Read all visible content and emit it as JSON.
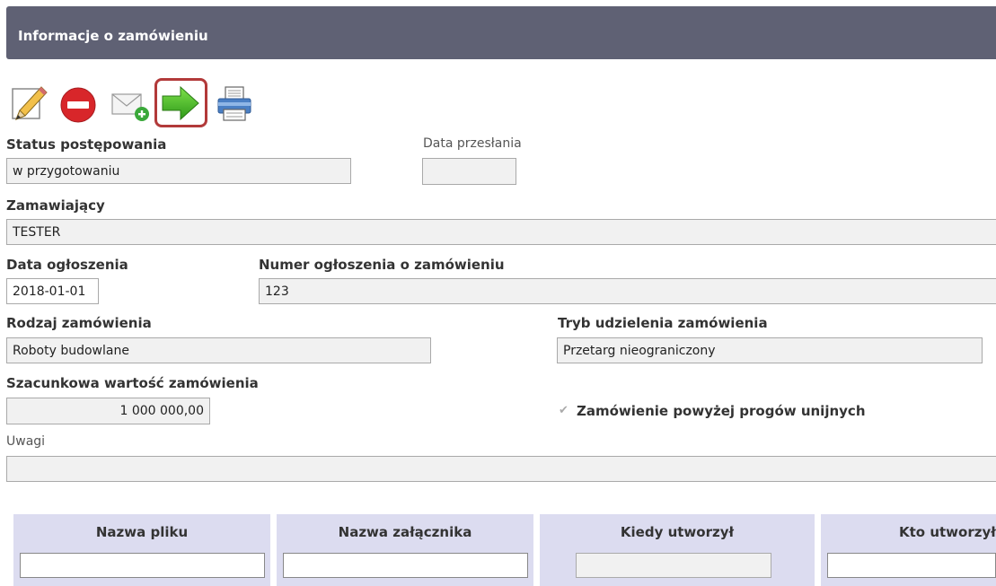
{
  "header": {
    "title": "Informacje o zamówieniu"
  },
  "toolbar": {
    "edit_icon": "pencil-icon",
    "delete_icon": "no-entry-icon",
    "message_icon": "envelope-add-icon",
    "forward_icon": "green-arrow-right-icon",
    "print_icon": "printer-icon",
    "highlight_color": "#b23a3a"
  },
  "form": {
    "status_label": "Status postępowania",
    "status_value": "w przygotowaniu",
    "sent_date_label": "Data przesłania",
    "sent_date_value": "",
    "buyer_label": "Zamawiający",
    "buyer_value": "TESTER",
    "notice_date_label": "Data ogłoszenia",
    "notice_date_value": "2018-01-01",
    "notice_number_label": "Numer ogłoszenia o zamówieniu",
    "notice_number_value": "123",
    "order_type_label": "Rodzaj zamówienia",
    "order_type_value": "Roboty budowlane",
    "procedure_label": "Tryb udzielenia zamówienia",
    "procedure_value": "Przetarg nieograniczony",
    "estimated_value_label": "Szacunkowa wartość zamówienia",
    "estimated_value": "1 000 000,00",
    "eu_threshold_label": "Zamówienie powyżej progów unijnych",
    "eu_threshold_checked": true,
    "notes_label": "Uwagi",
    "notes_value": ""
  },
  "attachments_table": {
    "columns": [
      "Nazwa pliku",
      "Nazwa załącznika",
      "Kiedy utworzył",
      "Kto utworzył"
    ]
  },
  "colors": {
    "header_bg": "#5f6174",
    "table_header_bg": "#dcdcf0",
    "field_bg": "#f1f1f1"
  }
}
